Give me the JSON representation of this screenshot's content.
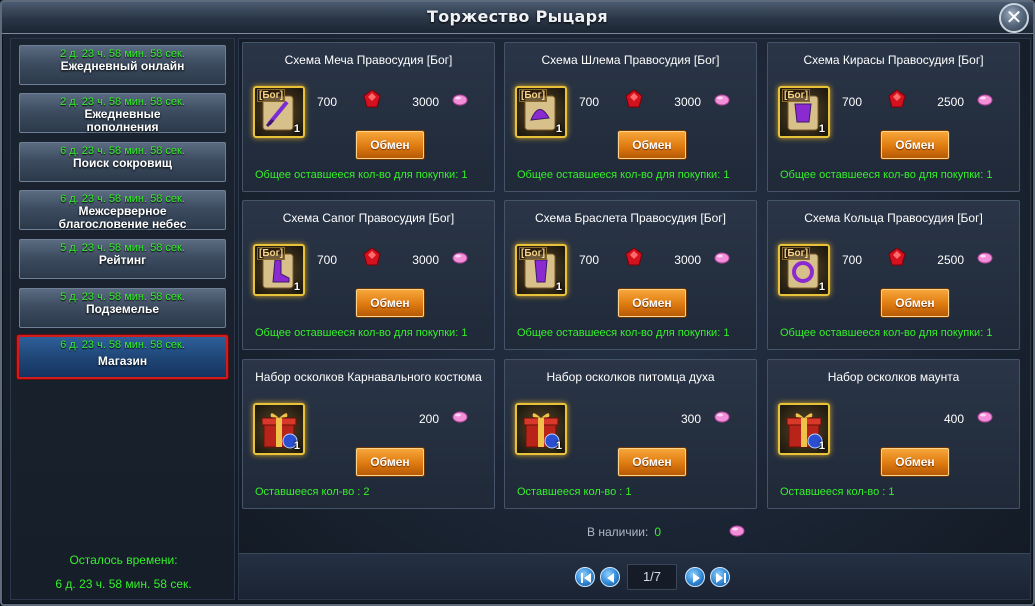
{
  "window": {
    "title": "Торжество Рыцаря",
    "close": "✕"
  },
  "sidebar": {
    "items": [
      {
        "timer": "2 д. 23 ч. 58 мин. 58 сек.",
        "label": "Ежедневный онлайн"
      },
      {
        "timer": "2 д. 23 ч. 58 мин. 58 сек.",
        "label": "Ежедневные пополнения"
      },
      {
        "timer": "6 д. 23 ч. 58 мин. 58 сек.",
        "label": "Поиск сокровищ"
      },
      {
        "timer": "6 д. 23 ч. 58 мин. 58 сек.",
        "label": "Межсерверное благословение небес"
      },
      {
        "timer": "5 д. 23 ч. 58 мин. 58 сек.",
        "label": "Рейтинг"
      },
      {
        "timer": "5 д. 23 ч. 58 мин. 58 сек.",
        "label": "Подземелье"
      },
      {
        "timer": "6 д. 23 ч. 58 мин. 58 сек.",
        "label": "Магазин"
      }
    ],
    "active_index": 6,
    "remaining_label": "Осталось времени:",
    "remaining_value": "6 д. 23 ч. 58 мин. 58 сек."
  },
  "cards": [
    {
      "name": "Схема Меча Правосудия [Бог]",
      "badge": "[Бог]",
      "qty": "1",
      "cost1": "700",
      "cost2": "3000",
      "button": "Обмен",
      "remain": "Общее оставшееся кол-во для покупки: 1",
      "icon": "sword-scroll-icon"
    },
    {
      "name": "Схема Шлема Правосудия [Бог]",
      "badge": "[Бог]",
      "qty": "1",
      "cost1": "700",
      "cost2": "3000",
      "button": "Обмен",
      "remain": "Общее оставшееся кол-во для покупки: 1",
      "icon": "helmet-scroll-icon"
    },
    {
      "name": "Схема Кирасы Правосудия [Бог]",
      "badge": "[Бог]",
      "qty": "1",
      "cost1": "700",
      "cost2": "2500",
      "button": "Обмен",
      "remain": "Общее оставшееся кол-во для покупки: 1",
      "icon": "cuirass-scroll-icon"
    },
    {
      "name": "Схема Сапог Правосудия [Бог]",
      "badge": "[Бог]",
      "qty": "1",
      "cost1": "700",
      "cost2": "3000",
      "button": "Обмен",
      "remain": "Общее оставшееся кол-во для покупки: 1",
      "icon": "boots-scroll-icon"
    },
    {
      "name": "Схема Браслета Правосудия [Бог]",
      "badge": "[Бог]",
      "qty": "1",
      "cost1": "700",
      "cost2": "3000",
      "button": "Обмен",
      "remain": "Общее оставшееся кол-во для покупки: 1",
      "icon": "bracelet-scroll-icon"
    },
    {
      "name": "Схема Кольца Правосудия [Бог]",
      "badge": "[Бог]",
      "qty": "1",
      "cost1": "700",
      "cost2": "2500",
      "button": "Обмен",
      "remain": "Общее оставшееся кол-во для покупки: 1",
      "icon": "ring-scroll-icon"
    },
    {
      "name": "Набор осколков Карнавального костюма",
      "badge": "",
      "qty": "1",
      "cost1": "",
      "cost2": "200",
      "button": "Обмен",
      "remain": "Оставшееся кол-во : 2",
      "icon": "gift-box-icon"
    },
    {
      "name": "Набор осколков питомца духа",
      "badge": "",
      "qty": "1",
      "cost1": "",
      "cost2": "300",
      "button": "Обмен",
      "remain": "Оставшееся кол-во : 1",
      "icon": "gift-box-icon"
    },
    {
      "name": "Набор осколков маунта",
      "badge": "",
      "qty": "1",
      "cost1": "",
      "cost2": "400",
      "button": "Обмен",
      "remain": "Оставшееся кол-во : 1",
      "icon": "gift-box-icon"
    }
  ],
  "stock": {
    "label": "В наличии:",
    "value": "0"
  },
  "pager": {
    "page": "1/7"
  },
  "colors": {
    "green_text": "#35f02a",
    "button_orange": "#de7a10",
    "active_border": "#d21c1c"
  }
}
